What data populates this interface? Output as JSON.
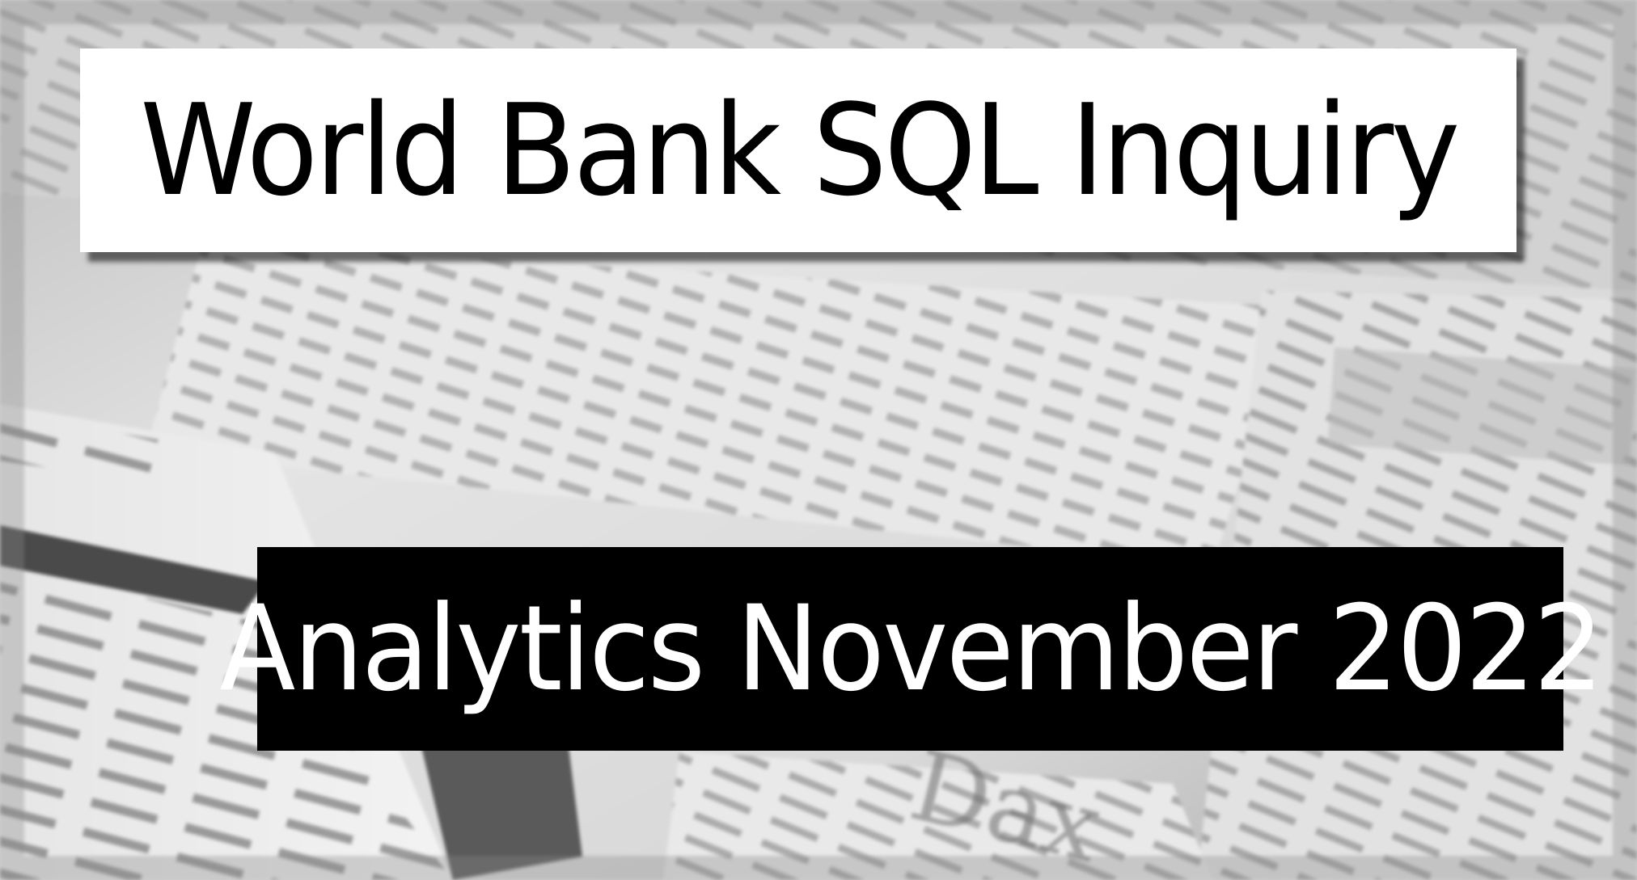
{
  "title": "World Bank SQL Inquiry",
  "subtitle": "Analytics November 2022",
  "colors": {
    "title_bg": "#ffffff",
    "title_text": "#000000",
    "subtitle_bg": "#000000",
    "subtitle_text": "#ffffff"
  },
  "background": {
    "description_icon": "newspaper-stock-table-photo"
  }
}
